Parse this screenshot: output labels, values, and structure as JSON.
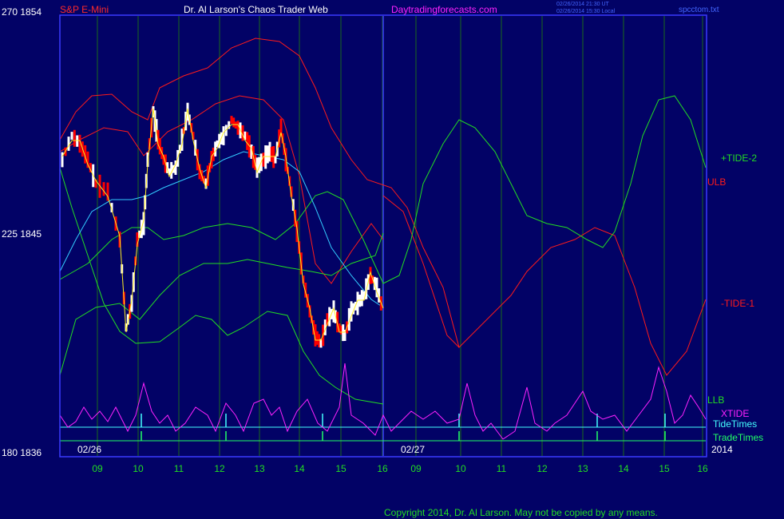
{
  "header": {
    "symbol": "S&P E-Mini",
    "title": "Dr. Al Larson's Chaos Trader Web",
    "site": "Daytradingforecasts.com",
    "timestamp_ut": "02/26/2014 21:30 UT",
    "timestamp_local": "02/26/2014 15:30 Local",
    "file": "spcctom.txt"
  },
  "y_axis": {
    "top_label": "270  1854",
    "mid_label": "225  1845",
    "bottom_label": "180  1836"
  },
  "copyright": "Copyright 2014, Dr. Al Larson. May not be copied by any means.",
  "colors": {
    "background": "#020266",
    "plot_border": "#3a3aff",
    "grid_vertical": "#1a6a1a",
    "price_up": "#ffffff",
    "price_down": "#ff0000",
    "band": "#ff1a1a",
    "green_lines": "#22dd22",
    "xtide": "#ff22ff",
    "yellow_avg": "#ffee22",
    "cyan_avg": "#33ccff",
    "tide_times": "#44ffff",
    "trade_times": "#22ff66",
    "axis_text_white": "#ffffff",
    "axis_text_green": "#22dd22"
  },
  "chart_data": {
    "type": "line",
    "title": "S&P E-Mini",
    "series": [
      {
        "name": "+TIDE-2",
        "color": "#22dd22"
      },
      {
        "name": "ULB",
        "color": "#ff1a1a"
      },
      {
        "name": "-TIDE-1",
        "color": "#ff1a1a"
      },
      {
        "name": "LLB",
        "color": "#22dd22"
      },
      {
        "name": "XTIDE",
        "color": "#ff22ff"
      },
      {
        "name": "TideTimes",
        "color": "#44ffff"
      },
      {
        "name": "TradeTimes",
        "color": "#22ff66"
      }
    ],
    "x_ticks": [
      "09",
      "10",
      "11",
      "12",
      "13",
      "14",
      "15",
      "16",
      "09",
      "10",
      "11",
      "12",
      "13",
      "14",
      "15",
      "16"
    ],
    "date_labels": [
      "02/26",
      "02/27"
    ],
    "year_label": "2014",
    "ylim": [
      1836,
      1854
    ]
  }
}
